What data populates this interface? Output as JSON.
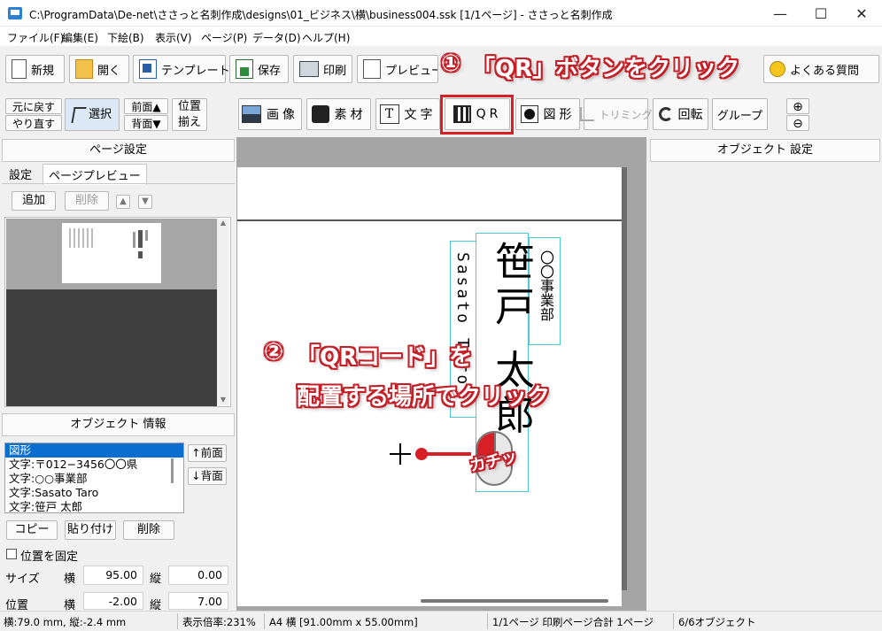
{
  "window": {
    "title": "C:\\ProgramData\\De-net\\ささっと名刺作成\\designs\\01_ビジネス\\横\\business004.ssk  [1/1ページ] - ささっと名刺作成",
    "minimize": "—",
    "maximize": "☐",
    "close": "✕"
  },
  "menu": [
    "ファイル(F)",
    "編集(E)",
    "下絵(B)",
    "表示(V)",
    "ページ(P)",
    "データ(D)",
    "ヘルプ(H)"
  ],
  "toolbar": {
    "new": "新規",
    "open": "開く",
    "template": "テンプレート",
    "save": "保存",
    "print": "印刷",
    "preview": "プレビュー",
    "faq": "よくある質問"
  },
  "edit": {
    "undo": "元に戻す",
    "redo": "やり直す",
    "select": "選択",
    "front": "前面▲",
    "back": "背面▼",
    "align_1": "位置",
    "align_2": "揃え"
  },
  "objects": {
    "image": "画像",
    "material": "素材",
    "text": "文字",
    "qr": "QR",
    "shape": "図形",
    "trimming": "トリミング",
    "rotate": "回転",
    "group": "グループ"
  },
  "zoom": {
    "in": "⊕",
    "out": "⊖"
  },
  "left_panel": {
    "page_settings": "ページ設定",
    "tab_settings": "設定",
    "tab_preview": "ページプレビュー",
    "add": "追加",
    "delete": "削除",
    "up": "▲",
    "down": "▼",
    "object_info": "オブジェクト 情報",
    "object_list": [
      "図形",
      "文字:〒012−3456〇〇県",
      "文字:○○事業部",
      "文字:Sasato Taro",
      "文字:笹戸 太郎"
    ],
    "move_front": "↑前面",
    "move_back": "↓背面",
    "copy": "コピー",
    "paste": "貼り付け",
    "remove": "削除",
    "lock_position": "位置を固定",
    "size_label": "サイズ",
    "position_label": "位置",
    "horizontal": "横",
    "vertical": "縦",
    "size_w": "95.00",
    "size_h": "0.00",
    "pos_x": "-2.00",
    "pos_y": "7.00"
  },
  "right_panel": {
    "object_settings": "オブジェクト 設定"
  },
  "card": {
    "department": "〇〇事業部",
    "name_romaji": "Sasato Taro",
    "name_kanji": "笹戸 太郎"
  },
  "annotations": {
    "step1_num": "①",
    "step1_text": "「QR」ボタンをクリック",
    "step2_num": "②",
    "step2_line1": "「QRコード」を",
    "step2_line2": "配置する場所でクリック",
    "click_sound": "カチッ"
  },
  "status": {
    "cursor": "横:79.0 mm, 縦:-2.4 mm",
    "zoom": "表示倍率:231%",
    "paper": "A4 横 [91.00mm x 55.00mm]",
    "pages": "1/1ページ 印刷ページ合計 1ページ",
    "objects": "6/6オブジェクト"
  },
  "colors": {
    "accent_red": "#d81f26",
    "selection_blue": "#0a6ed1",
    "guide_cyan": "#4bcad6"
  }
}
